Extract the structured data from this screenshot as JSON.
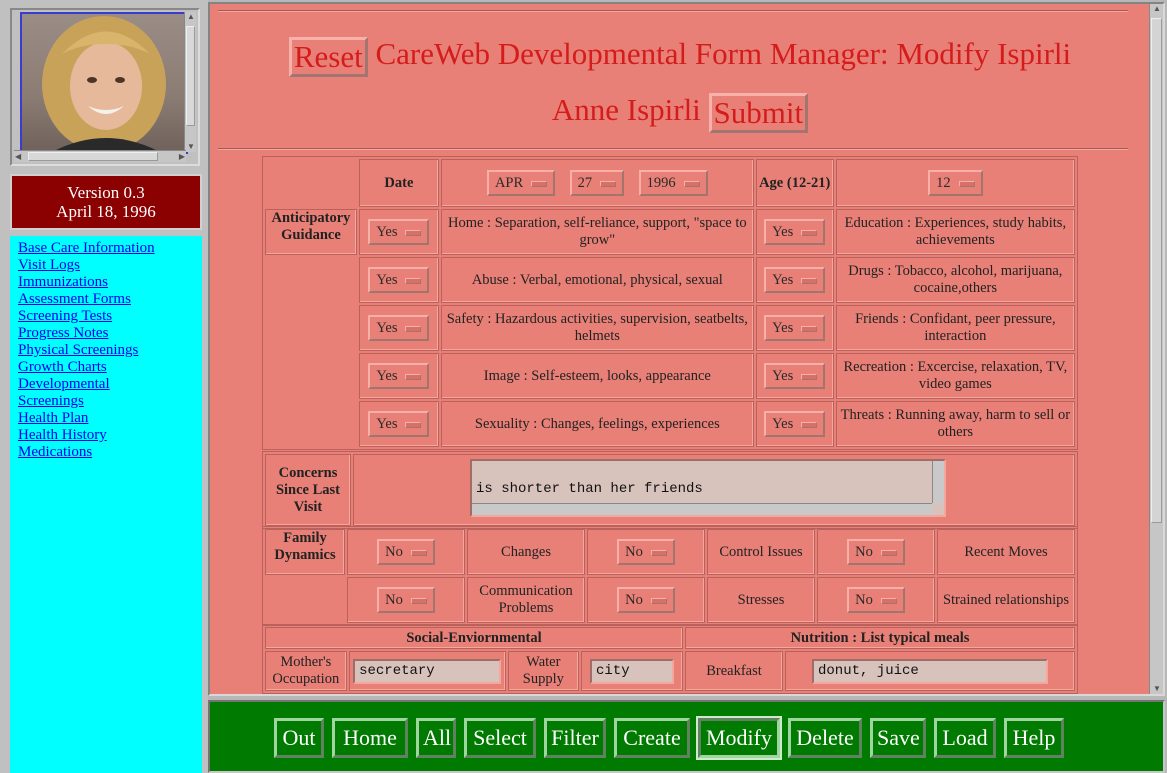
{
  "sidebar": {
    "version": "Version 0.3",
    "date": "April 18, 1996",
    "links": [
      "Base Care Information",
      "Visit Logs",
      "Immunizations",
      "Assessment Forms",
      "Screening Tests",
      "Progress Notes",
      "Physical Screenings",
      "Growth Charts",
      "Developmental",
      "Screenings",
      "Health Plan",
      "Health History",
      "Medications"
    ]
  },
  "header": {
    "reset_label": "Reset",
    "title": "CareWeb Developmental Form Manager: Modify Ispirli",
    "patient": "Anne Ispirli",
    "submit_label": "Submit"
  },
  "date_row": {
    "date_label": "Date",
    "month": "APR",
    "day": "27",
    "year": "1996",
    "age_label": "Age (12-21)",
    "age": "12"
  },
  "guidance": {
    "label": "Anticipatory Guidance",
    "rows": [
      {
        "v1": "Yes",
        "t1": "Home : Separation, self-reliance, support, \"space to grow\"",
        "v2": "Yes",
        "t2": "Education : Experiences, study habits, achievements"
      },
      {
        "v1": "Yes",
        "t1": "Abuse : Verbal, emotional, physical, sexual",
        "v2": "Yes",
        "t2": "Drugs : Tobacco, alcohol, marijuana, cocaine,others"
      },
      {
        "v1": "Yes",
        "t1": "Safety : Hazardous activities, supervision, seatbelts, helmets",
        "v2": "Yes",
        "t2": "Friends : Confidant, peer pressure, interaction"
      },
      {
        "v1": "Yes",
        "t1": "Image : Self-esteem, looks, appearance",
        "v2": "Yes",
        "t2": "Recreation : Excercise, relaxation, TV, video games"
      },
      {
        "v1": "Yes",
        "t1": "Sexuality : Changes, feelings, experiences",
        "v2": "Yes",
        "t2": "Threats : Running away, harm to sell or others"
      }
    ]
  },
  "concerns": {
    "label": "Concerns Since Last Visit",
    "value": "is shorter than her friends"
  },
  "family": {
    "label": "Family Dynamics",
    "rows": [
      {
        "a": "No",
        "at": "Changes",
        "b": "No",
        "bt": "Control Issues",
        "c": "No",
        "ct": "Recent Moves"
      },
      {
        "a": "No",
        "at": "Communication Problems",
        "b": "No",
        "bt": "Stresses",
        "c": "No",
        "ct": "Strained relationships"
      }
    ]
  },
  "social": {
    "header": "Social-Enviornmental",
    "mother_label": "Mother's Occupation",
    "mother_value": "secretary",
    "water_label": "Water Supply",
    "water_value": "city"
  },
  "nutrition": {
    "header": "Nutrition : List typical meals",
    "breakfast_label": "Breakfast",
    "breakfast_value": "donut, juice"
  },
  "toolbar": [
    "Out",
    "Home",
    "All",
    "Select",
    "Filter",
    "Create",
    "Modify",
    "Delete",
    "Save",
    "Load",
    "Help"
  ],
  "colors": {
    "form_bg": "#e88077",
    "title_red": "#d41c1c",
    "toolbar_green": "#007a00",
    "nav_bg": "#00ffff",
    "version_bg": "#8b0000"
  }
}
